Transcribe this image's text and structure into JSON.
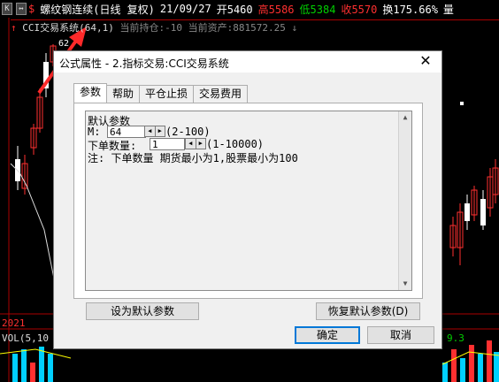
{
  "topbar": {
    "title": "螺纹钢连续(日线 复权)",
    "date": "21/09/27",
    "open_label": "开5460",
    "high_label": "高5586",
    "low_label": "低5384",
    "close_label": "收5570",
    "turnover_label": "换175.66%",
    "volume_label": "量"
  },
  "subbar": {
    "strategy": "CCI交易系统(64,1)",
    "position": "当前持仓:-10",
    "assets": "当前资产:881572.25"
  },
  "chart": {
    "price_label": "62",
    "year_label": "2021",
    "vol_label": "VOL(5,10",
    "right_value": "9.3"
  },
  "dialog": {
    "title": "公式属性 - 2.指标交易:CCI交易系统",
    "close_glyph": "✕",
    "tabs": [
      {
        "label": "参数"
      },
      {
        "label": "帮助"
      },
      {
        "label": "平仓止损"
      },
      {
        "label": "交易费用"
      }
    ],
    "params": {
      "header": "默认参数",
      "m_label": "M:",
      "m_value": "64",
      "m_range": "(2-100)",
      "qty_label": "下单数量:",
      "qty_value": "1",
      "qty_range": "(1-10000)",
      "note": "注: 下单数量 期货最小为1,股票最小为100"
    },
    "buttons": {
      "set_default": "设为默认参数",
      "restore_default": "恢复默认参数(D)",
      "ok": "确定",
      "cancel": "取消"
    }
  },
  "colors": {
    "up": "#ff3030",
    "down": "#00d000",
    "accent": "#0078d7"
  }
}
